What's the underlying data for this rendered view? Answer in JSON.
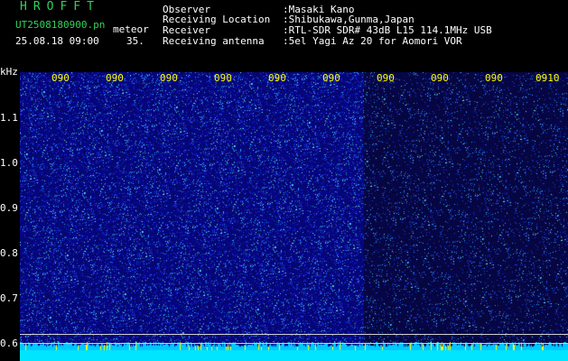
{
  "header": {
    "app_title": "HROFFT",
    "file_name": "UT2508180900.pn",
    "meteor_label": "meteor",
    "datetime": "25.08.18 09:00",
    "count": "35."
  },
  "info": [
    {
      "label": "Observer",
      "value": ":Masaki Kano"
    },
    {
      "label": "Receiving Location",
      "value": ":Shibukawa,Gunma,Japan"
    },
    {
      "label": "Receiver",
      "value": ":RTL-SDR SDR# 43dB L15 114.1MHz USB"
    },
    {
      "label": "Receiving antenna",
      "value": ":5el Yagi Az 20 for Aomori VOR"
    }
  ],
  "y_axis": {
    "unit": "kHz",
    "ticks": [
      "1.1",
      "1.0",
      "0.9",
      "0.8",
      "0.7",
      "0.6"
    ]
  },
  "x_axis": {
    "ticks": [
      "090",
      "090",
      "090",
      "090",
      "090",
      "090",
      "090",
      "090",
      "090",
      "0910"
    ]
  },
  "colors": {
    "background": "#000000",
    "spectrogram_base": "#0a0a96",
    "header_green": "#2fd25a",
    "time_tick": "#ffff00",
    "bottom_band": "#00e5ff"
  }
}
